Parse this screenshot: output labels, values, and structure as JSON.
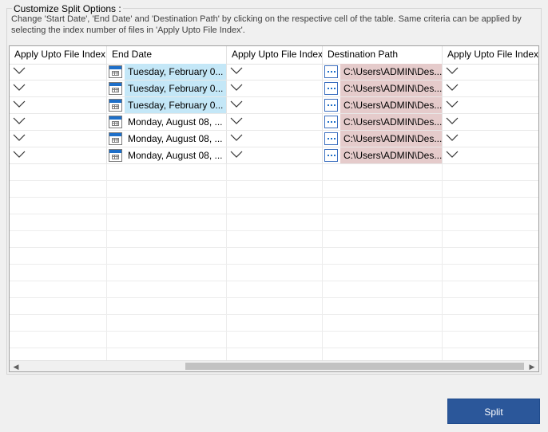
{
  "group": {
    "title": "Customize Split Options :",
    "description": "Change 'Start Date', 'End Date' and 'Destination Path' by clicking on the respective cell of the table. Same criteria can be applied by selecting the index number of files in 'Apply Upto File Index'."
  },
  "table": {
    "headers": [
      "Apply Upto File Index",
      "End Date",
      "Apply Upto File Index",
      "Destination Path",
      "Apply Upto File Index"
    ],
    "rows": [
      {
        "end_date": "Tuesday, February 0...",
        "path": "C:\\Users\\ADMIN\\Des...",
        "highlight": true
      },
      {
        "end_date": "Tuesday, February 0...",
        "path": "C:\\Users\\ADMIN\\Des...",
        "highlight": true
      },
      {
        "end_date": "Tuesday, February 0...",
        "path": "C:\\Users\\ADMIN\\Des...",
        "highlight": true
      },
      {
        "end_date": "Monday, August 08, ...",
        "path": "C:\\Users\\ADMIN\\Des...",
        "highlight": false
      },
      {
        "end_date": "Monday, August 08, ...",
        "path": "C:\\Users\\ADMIN\\Des...",
        "highlight": false
      },
      {
        "end_date": "Monday, August 08, ...",
        "path": "C:\\Users\\ADMIN\\Des...",
        "highlight": false
      }
    ],
    "empty_rows": 12
  },
  "icons": {
    "dropdown": "chevron-down-icon",
    "calendar": "calendar-icon",
    "browse": "browse-dots-icon",
    "scroll_left": "scroll-left-icon",
    "scroll_right": "scroll-right-icon"
  },
  "colors": {
    "date_highlight": "#c4e7f7",
    "path_highlight": "#e5cbcb",
    "split_button": "#2b579a"
  },
  "split_button": {
    "label": "Split"
  }
}
